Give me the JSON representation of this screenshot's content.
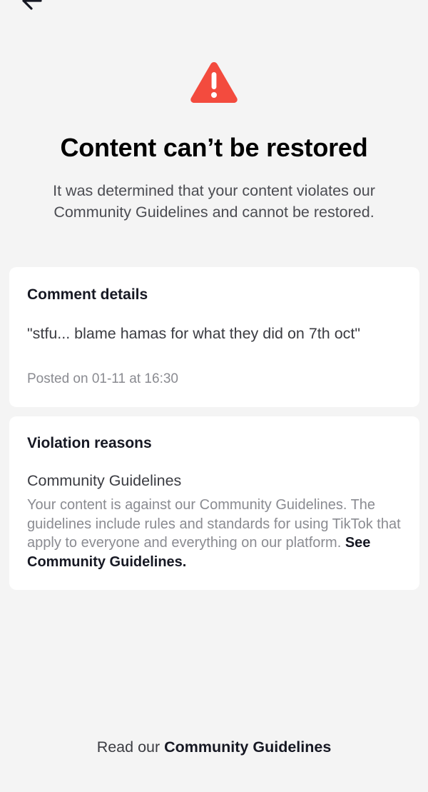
{
  "header": {
    "back_icon": "arrow-left-icon"
  },
  "status": {
    "icon": "warning-triangle-icon",
    "icon_color": "#fe2c55",
    "title": "Content can’t be restored",
    "description": "It was determined that your content violates our Community Guidelines and cannot be restored."
  },
  "comment_card": {
    "heading": "Comment details",
    "comment": "\"stfu... blame hamas for what they did on 7th oct\"",
    "posted": "Posted on 01-11 at 16:30"
  },
  "violation_card": {
    "heading": "Violation reasons",
    "reason_title": "Community Guidelines",
    "reason_body": "Your content is against our Community Guidelines. The guidelines include rules and standards for using TikTok that apply to everyone and everything on our platform.",
    "reason_link": "See Community Guidelines."
  },
  "footer": {
    "prefix": "Read our",
    "link": "Community Guidelines"
  },
  "colors": {
    "background": "#f4f4f4",
    "card": "#ffffff",
    "warning": "#fe2c55"
  }
}
